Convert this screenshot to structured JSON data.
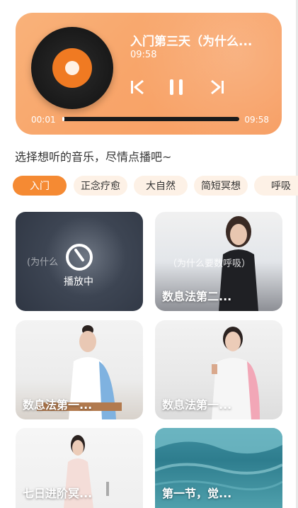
{
  "player": {
    "title": "入门第三天（为什么...",
    "duration": "09:58",
    "current_time": "00:01",
    "total_time": "09:58",
    "progress": 0.01,
    "controls": {
      "prev_icon": "skip-previous-icon",
      "pause_icon": "pause-icon",
      "next_icon": "skip-next-icon"
    }
  },
  "prompt": "选择想听的音乐，尽情点播吧~",
  "tabs": [
    {
      "label": "入门",
      "active": true
    },
    {
      "label": "正念疗愈"
    },
    {
      "label": "大自然"
    },
    {
      "label": "简短冥想"
    },
    {
      "label": "呼吸"
    }
  ],
  "cards": [
    {
      "title": "",
      "subtitle": "(为什么",
      "status": "播放中"
    },
    {
      "title": "数息法第二...",
      "subtitle": "（为什么要数呼吸）"
    },
    {
      "title": "数息法第一..."
    },
    {
      "title": "数息法第一..."
    },
    {
      "title": "七日进阶冥..."
    },
    {
      "title": "第一节，觉..."
    }
  ],
  "colors": {
    "accent": "#f58a33",
    "tab_bg": "#fdf1e6"
  }
}
